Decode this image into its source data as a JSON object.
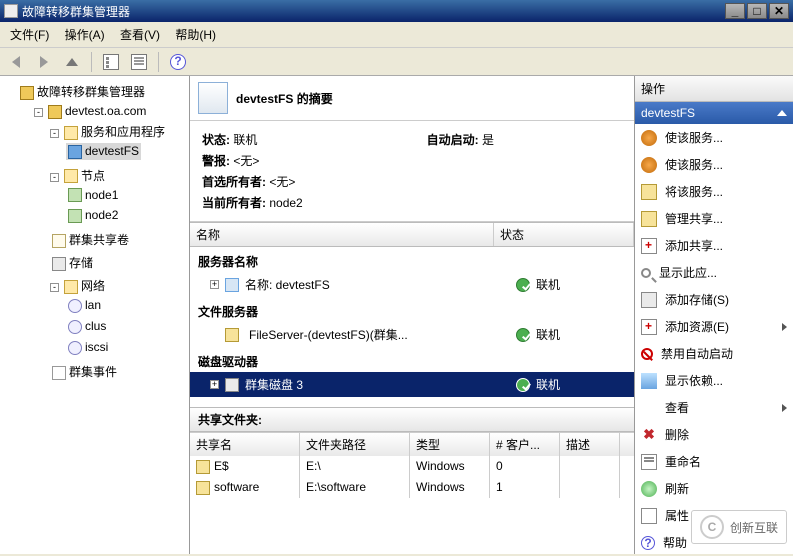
{
  "window": {
    "title": "故障转移群集管理器"
  },
  "menu": {
    "file": "文件(F)",
    "action": "操作(A)",
    "view": "查看(V)",
    "help": "帮助(H)"
  },
  "tree": {
    "root": "故障转移群集管理器",
    "cluster": "devtest.oa.com",
    "svcapps": "服务和应用程序",
    "svcapp_item": "devtestFS",
    "nodes": "节点",
    "node1": "node1",
    "node2": "node2",
    "csv": "群集共享卷",
    "storage": "存储",
    "networks": "网络",
    "net_lan": "lan",
    "net_clus": "clus",
    "net_iscsi": "iscsi",
    "events": "群集事件"
  },
  "summary": {
    "title_pre": "devtestFS",
    "title_suf": " 的摘要",
    "status_lbl": "状态:",
    "status_val": "联机",
    "alerts_lbl": "警报:",
    "alerts_val": "<无>",
    "pref_lbl": "首选所有者:",
    "pref_val": "<无>",
    "curr_lbl": "当前所有者:",
    "curr_val": "node2",
    "auto_lbl": "自动启动:",
    "auto_val": "是"
  },
  "cols": {
    "name": "名称",
    "status": "状态"
  },
  "sections": {
    "servername_title": "服务器名称",
    "servername_line": "名称: devtestFS",
    "servername_status": "联机",
    "fs_title": "文件服务器",
    "fs_line": "FileServer-(devtestFS)(群集...",
    "fs_status": "联机",
    "disk_title": "磁盘驱动器",
    "disk_line": "群集磁盘 3",
    "disk_status": "联机"
  },
  "shares": {
    "title": "共享文件夹:",
    "headers": {
      "name": "共享名",
      "path": "文件夹路径",
      "type": "类型",
      "clients": "# 客户...",
      "desc": "描述"
    },
    "rows": [
      {
        "name": "E$",
        "path": "E:\\",
        "type": "Windows",
        "clients": "0",
        "desc": ""
      },
      {
        "name": "software",
        "path": "E:\\software",
        "type": "Windows",
        "clients": "1",
        "desc": ""
      }
    ]
  },
  "actions": {
    "header": "操作",
    "context": "devtestFS",
    "items": [
      {
        "label": "使该服务...",
        "icon": "gear"
      },
      {
        "label": "使该服务...",
        "icon": "gear"
      },
      {
        "label": "将该服务...",
        "icon": "share"
      },
      {
        "label": "管理共享...",
        "icon": "share"
      },
      {
        "label": "添加共享...",
        "icon": "plus"
      },
      {
        "label": "显示此应...",
        "icon": "mag"
      },
      {
        "label": "添加存储(S)",
        "icon": "disk"
      },
      {
        "label": "添加资源(E)",
        "icon": "plus",
        "sub": true
      },
      {
        "label": "禁用自动启动",
        "icon": "no"
      },
      {
        "label": "显示依赖...",
        "icon": "dep"
      },
      {
        "label": "查看",
        "icon": "",
        "sub": true
      },
      {
        "label": "删除",
        "icon": "del"
      },
      {
        "label": "重命名",
        "icon": "ren"
      },
      {
        "label": "刷新",
        "icon": "ref"
      },
      {
        "label": "属性",
        "icon": "prop"
      },
      {
        "label": "帮助",
        "icon": "help"
      }
    ]
  },
  "watermark": "创新互联"
}
